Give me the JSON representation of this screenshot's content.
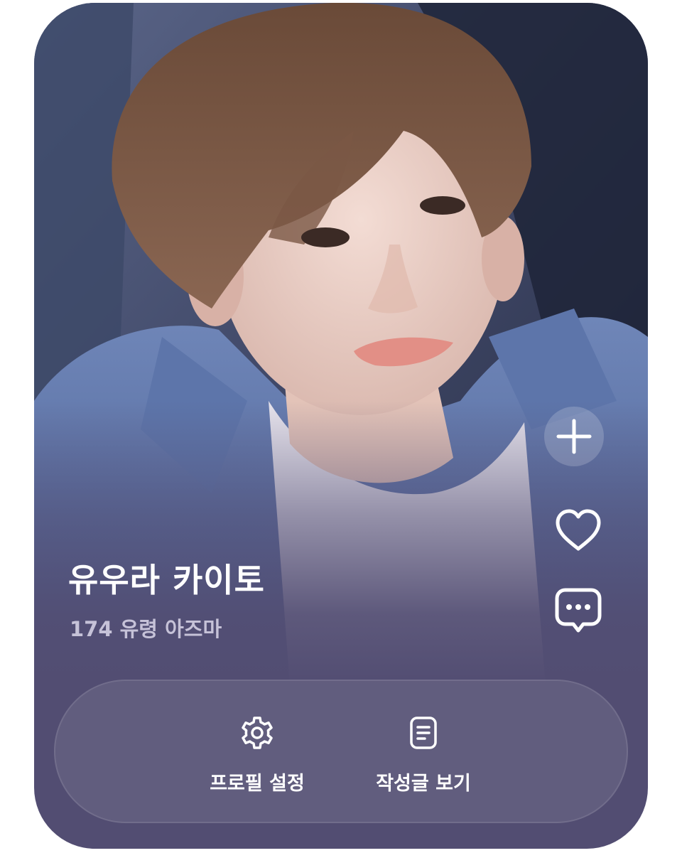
{
  "profile": {
    "name": "유우라 카이토",
    "subtitle": "174 유령 아즈마"
  },
  "side_actions": {
    "add_icon": "plus-icon",
    "like_icon": "heart-icon",
    "chat_icon": "chat-bubble-icon"
  },
  "actions": {
    "settings": {
      "label": "프로필 설정",
      "icon": "gear-icon"
    },
    "posts": {
      "label": "작성글 보기",
      "icon": "document-icon"
    }
  },
  "colors": {
    "card_background": "#524d72",
    "subtitle_text": "#c6c2d8",
    "text": "#ffffff"
  }
}
